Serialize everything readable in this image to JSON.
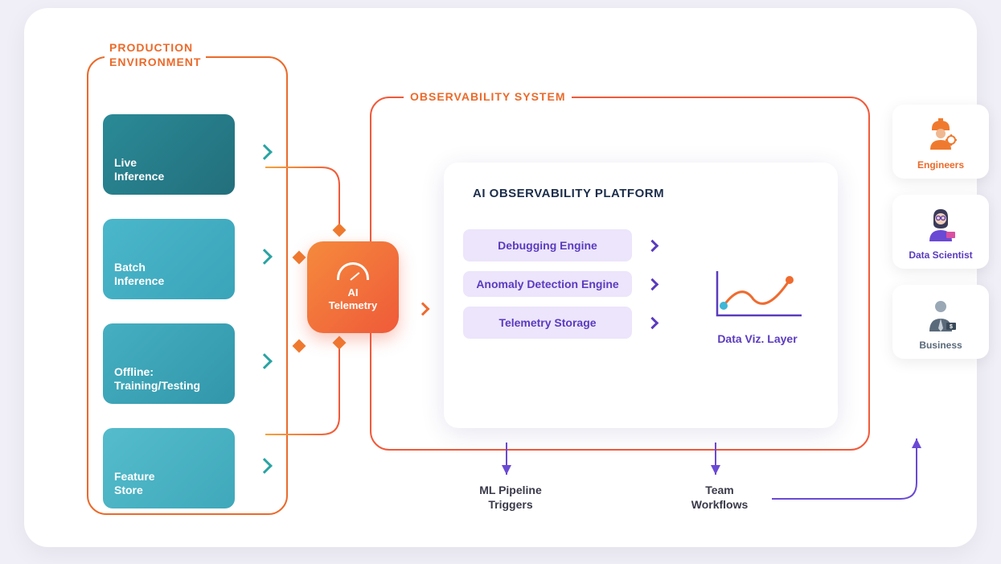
{
  "production": {
    "title_line1": "PRODUCTION",
    "title_line2": "ENVIRONMENT",
    "boxes": [
      {
        "label_line1": "Live",
        "label_line2": "Inference"
      },
      {
        "label_line1": "Batch",
        "label_line2": "Inference"
      },
      {
        "label_line1": "Offline:",
        "label_line2": "Training/Testing"
      },
      {
        "label_line1": "Feature",
        "label_line2": "Store"
      }
    ]
  },
  "telemetry": {
    "label_line1": "AI",
    "label_line2": "Telemetry"
  },
  "observability": {
    "title": "OBSERVABILITY SYSTEM",
    "platform_title": "AI OBSERVABILITY PLATFORM",
    "engines": [
      "Debugging Engine",
      "Anomaly Detection Engine",
      "Telemetry Storage"
    ],
    "viz_label": "Data Viz. Layer"
  },
  "outputs": {
    "ml_line1": "ML Pipeline",
    "ml_line2": "Triggers",
    "team_line1": "Team",
    "team_line2": "Workflows"
  },
  "personas": {
    "engineers": "Engineers",
    "data_scientist": "Data Scientist",
    "business": "Business"
  }
}
